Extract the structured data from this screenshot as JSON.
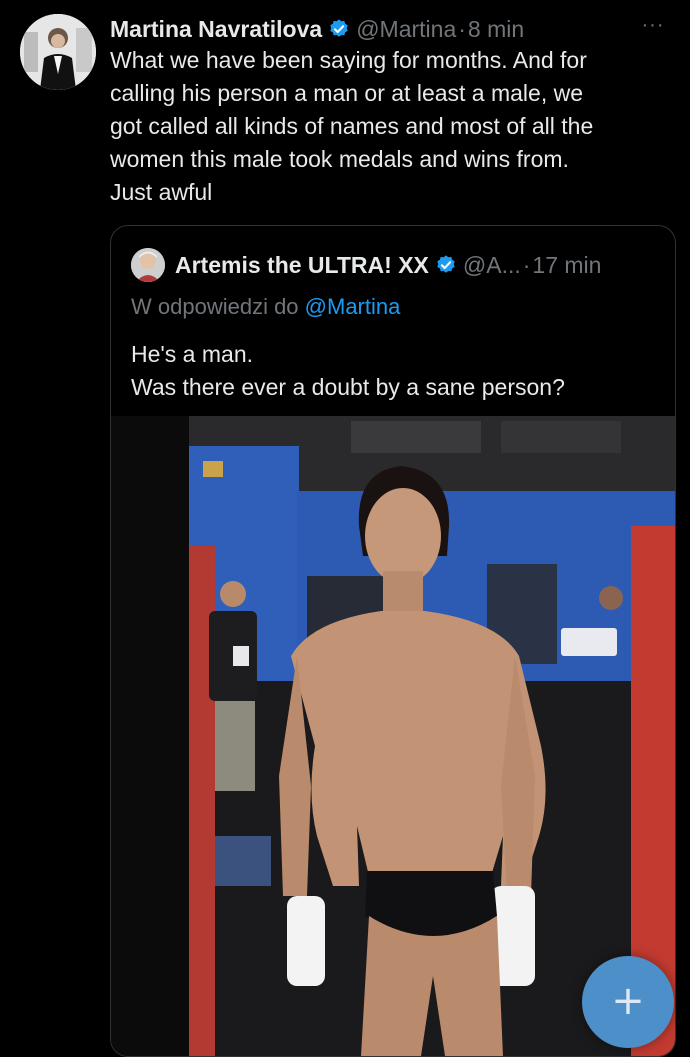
{
  "tweet": {
    "author_name": "Martina Navratilova",
    "handle": "@Martina",
    "separator": "·",
    "time": "8 min",
    "more_label": "···",
    "text": "What we have been saying for months. And for\ncalling his person a man or at least a male, we\ngot called all kinds of names and most of all the\nwomen this male took medals and wins from.\nJust awful"
  },
  "quoted_tweet": {
    "author_name": "Artemis the ULTRA! XX",
    "handle": "@A...",
    "separator": "·",
    "time": "17 min",
    "reply_prefix": "W odpowiedzi do ",
    "reply_mention": "@Martina",
    "text": "He's a man.\nWas there ever a doubt by a sane person?",
    "media_icon": "photo-boxer-weigh-in"
  },
  "compose_button": {
    "icon": "plus-icon",
    "label": "+"
  },
  "colors": {
    "background": "#000000",
    "text": "#e7e9ea",
    "muted": "#71767b",
    "link": "#1d9bf0",
    "verified": "#1d9bf0",
    "fab": "#4d8fc9"
  }
}
